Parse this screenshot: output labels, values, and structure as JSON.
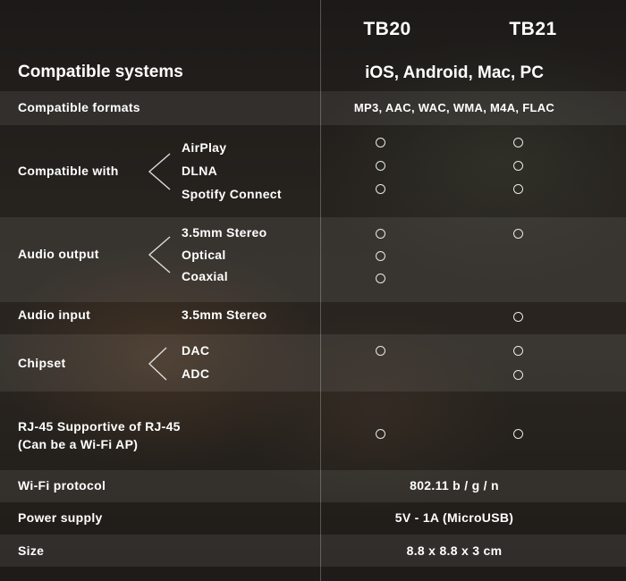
{
  "header": {
    "col1": "TB20",
    "col2": "TB21"
  },
  "rows": {
    "systems": {
      "label": "Compatible systems",
      "value": "iOS, Android, Mac, PC"
    },
    "formats": {
      "label": "Compatible formats",
      "value": "MP3, AAC, WAC, WMA, M4A, FLAC"
    },
    "compat": {
      "label": "Compatible with",
      "items": [
        "AirPlay",
        "DLNA",
        "Spotify Connect"
      ],
      "tb20": [
        true,
        true,
        true
      ],
      "tb21": [
        true,
        true,
        true
      ]
    },
    "audio_out": {
      "label": "Audio output",
      "items": [
        "3.5mm Stereo",
        "Optical",
        "Coaxial"
      ],
      "tb20": [
        true,
        true,
        true
      ],
      "tb21": [
        true,
        false,
        false
      ]
    },
    "audio_in": {
      "label": "Audio input",
      "items": [
        "3.5mm Stereo"
      ],
      "tb20": [
        false
      ],
      "tb21": [
        true
      ]
    },
    "chipset": {
      "label": "Chipset",
      "items": [
        "DAC",
        "ADC"
      ],
      "tb20": [
        true,
        false
      ],
      "tb21": [
        true,
        true
      ]
    },
    "rj45": {
      "label_line1": "RJ-45 Supportive of RJ-45",
      "label_line2": "(Can be a Wi-Fi AP)",
      "tb20": true,
      "tb21": true
    },
    "wifi": {
      "label": "Wi-Fi protocol",
      "value": "802.11 b / g / n"
    },
    "power": {
      "label": "Power supply",
      "value": "5V - 1A (MicroUSB)"
    },
    "size": {
      "label": "Size",
      "value": "8.8 x 8.8 x 3 cm"
    }
  },
  "icons": {
    "supported": "circle-outline-icon",
    "bracket": "left-chevron-icon"
  }
}
